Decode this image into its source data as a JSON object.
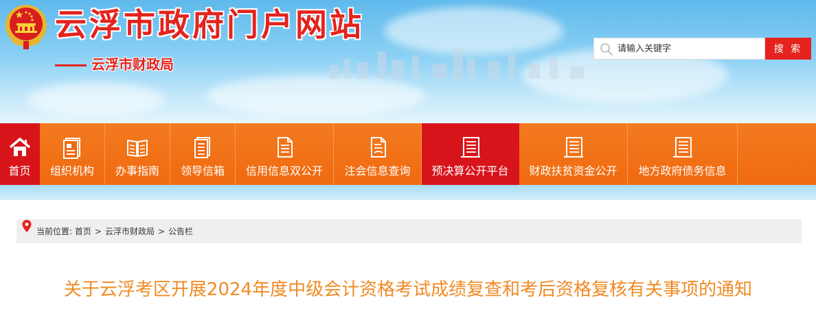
{
  "header": {
    "site_title": "云浮市政府门户网站",
    "dept_name": "云浮市财政局",
    "search": {
      "placeholder": "请输入关键字",
      "button_label": "搜 索"
    }
  },
  "nav": {
    "items": [
      {
        "label": "首页",
        "icon": "home-icon",
        "active": true
      },
      {
        "label": "组织机构",
        "icon": "org-card-icon",
        "active": false
      },
      {
        "label": "办事指南",
        "icon": "book-icon",
        "active": false
      },
      {
        "label": "领导信箱",
        "icon": "mailbox-icon",
        "active": false
      },
      {
        "label": "信用信息双公开",
        "icon": "document-icon",
        "active": false
      },
      {
        "label": "注会信息查询",
        "icon": "document-search-icon",
        "active": false
      },
      {
        "label": "预决算公开平台",
        "icon": "report-icon",
        "active": true
      },
      {
        "label": "财政扶贫资金公开",
        "icon": "report-icon",
        "active": false
      },
      {
        "label": "地方政府债务信息",
        "icon": "report-icon",
        "active": false
      }
    ]
  },
  "breadcrumb": {
    "prefix": "当前位置:",
    "items": [
      "首页",
      "云浮市财政局",
      "公告栏"
    ],
    "separator": ">"
  },
  "article": {
    "title": "关于云浮考区开展2024年度中级会计资格考试成绩复查和考后资格复核有关事项的通知"
  },
  "colors": {
    "brand_red": "#e4231e",
    "nav_orange": "#f06a10",
    "nav_active": "#d8141b",
    "title_orange": "#f08a24"
  }
}
